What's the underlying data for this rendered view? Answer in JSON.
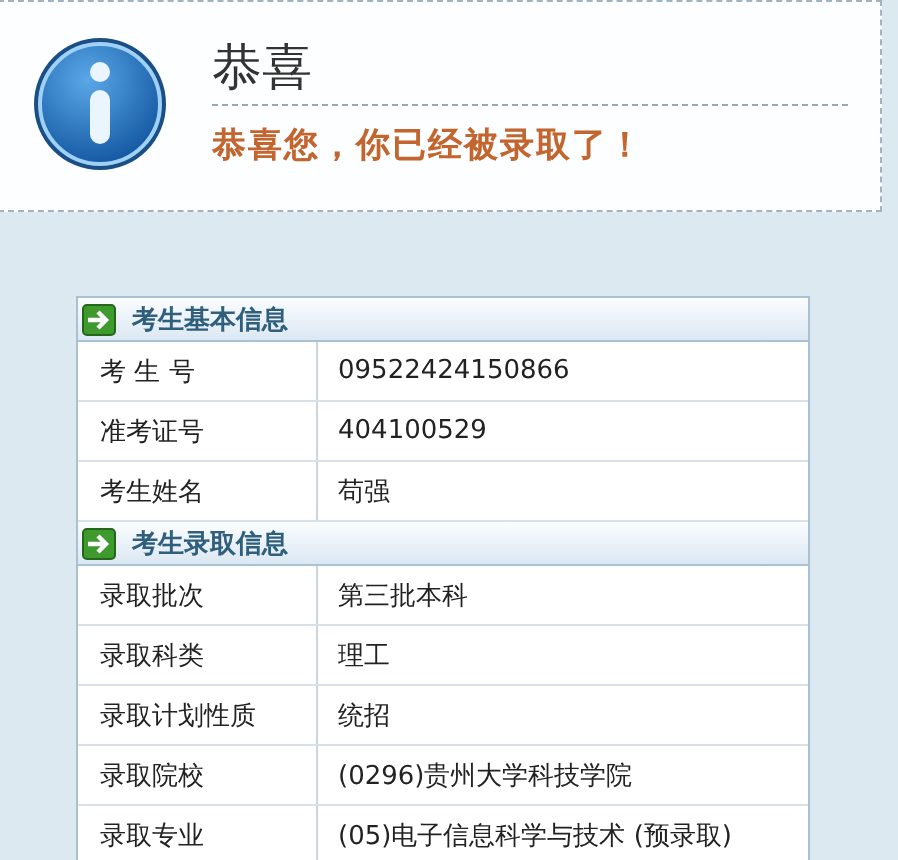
{
  "notice": {
    "title": "恭喜",
    "message": "恭喜您，你已经被录取了！"
  },
  "sections": [
    {
      "title": "考生基本信息",
      "rows": [
        {
          "label": "考 生 号",
          "value": "09522424150866"
        },
        {
          "label": "准考证号",
          "value": "404100529"
        },
        {
          "label": "考生姓名",
          "value": "苟强"
        }
      ]
    },
    {
      "title": "考生录取信息",
      "rows": [
        {
          "label": "录取批次",
          "value": "第三批本科"
        },
        {
          "label": "录取科类",
          "value": "理工"
        },
        {
          "label": "录取计划性质",
          "value": "统招"
        },
        {
          "label": "录取院校",
          "value": "(0296)贵州大学科技学院"
        },
        {
          "label": "录取专业",
          "value": "(05)电子信息科学与技术 (预录取)"
        }
      ]
    }
  ]
}
